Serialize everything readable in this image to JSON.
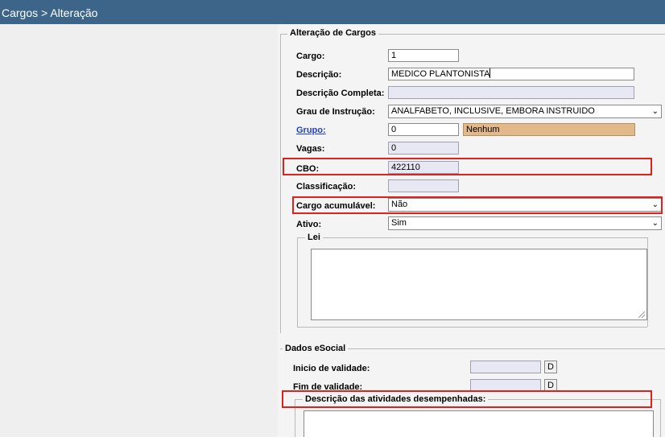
{
  "header": {
    "title": "Cargos > Alteração"
  },
  "form": {
    "legend": "Alteração de Cargos",
    "cargo": {
      "label": "Cargo:",
      "value": "1"
    },
    "descricao": {
      "label": "Descrição:",
      "value": "MEDICO PLANTONISTA"
    },
    "descricao_completa": {
      "label": "Descrição Completa:",
      "value": ""
    },
    "grau_instrucao": {
      "label": "Grau de Instrução:",
      "value": "ANALFABETO, INCLUSIVE, EMBORA INSTRUIDO"
    },
    "grupo": {
      "label": "Grupo:",
      "value": "0",
      "name": "Nenhum"
    },
    "vagas": {
      "label": "Vagas:",
      "value": "0"
    },
    "cbo": {
      "label": "CBO:",
      "value": "422110"
    },
    "classificacao": {
      "label": "Classificação:",
      "value": ""
    },
    "cargo_acumulavel": {
      "label": "Cargo acumulável:",
      "value": "Não"
    },
    "ativo": {
      "label": "Ativo:",
      "value": "Sim"
    },
    "lei": {
      "legend": "Lei",
      "value": ""
    }
  },
  "esocial": {
    "legend": "Dados eSocial",
    "inicio_validade": {
      "label": "Inicio de validade:",
      "value": "",
      "button": "D"
    },
    "fim_validade": {
      "label": "Fim de validade:",
      "value": "",
      "button": "D"
    },
    "atividades": {
      "legend": "Descrição das atividades desempenhadas:",
      "value": ""
    }
  },
  "colors": {
    "titlebar": "#3c6589",
    "highlight": "#e0201c",
    "readonly": "#e8e8f4",
    "group_name": "#e1b98a"
  }
}
